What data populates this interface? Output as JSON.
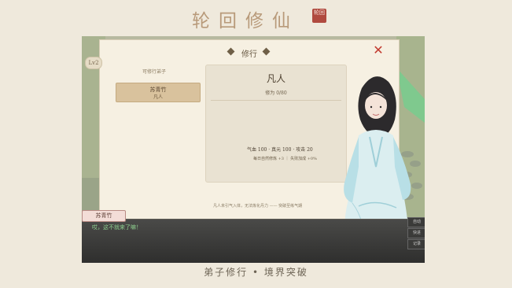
{
  "app": {
    "title": "轮回修仙",
    "seal_text": "轮回"
  },
  "panel": {
    "title": "修行",
    "close_label": "✕",
    "level_badge": "Lv2"
  },
  "disciple_list": {
    "header": "可修行弟子",
    "items": [
      {
        "name": "苏青竹",
        "realm": "凡人"
      }
    ]
  },
  "realm_card": {
    "realm": "凡人",
    "progress": "修为 0/80",
    "stats": "气血 100 · 真元 100 · 攻击 20",
    "rates": "每日自然修炼 +3 ｜ 失败加成 +0%"
  },
  "description": "凡人未引气入体，无法炼化丹力 —— 突破至练气期",
  "dialogue": {
    "speaker": "苏青竹",
    "text": "哎，这不就来了嘛！",
    "side_buttons": [
      "自动",
      "快进",
      "记录"
    ]
  },
  "caption": "弟子修行 • 境界突破"
}
